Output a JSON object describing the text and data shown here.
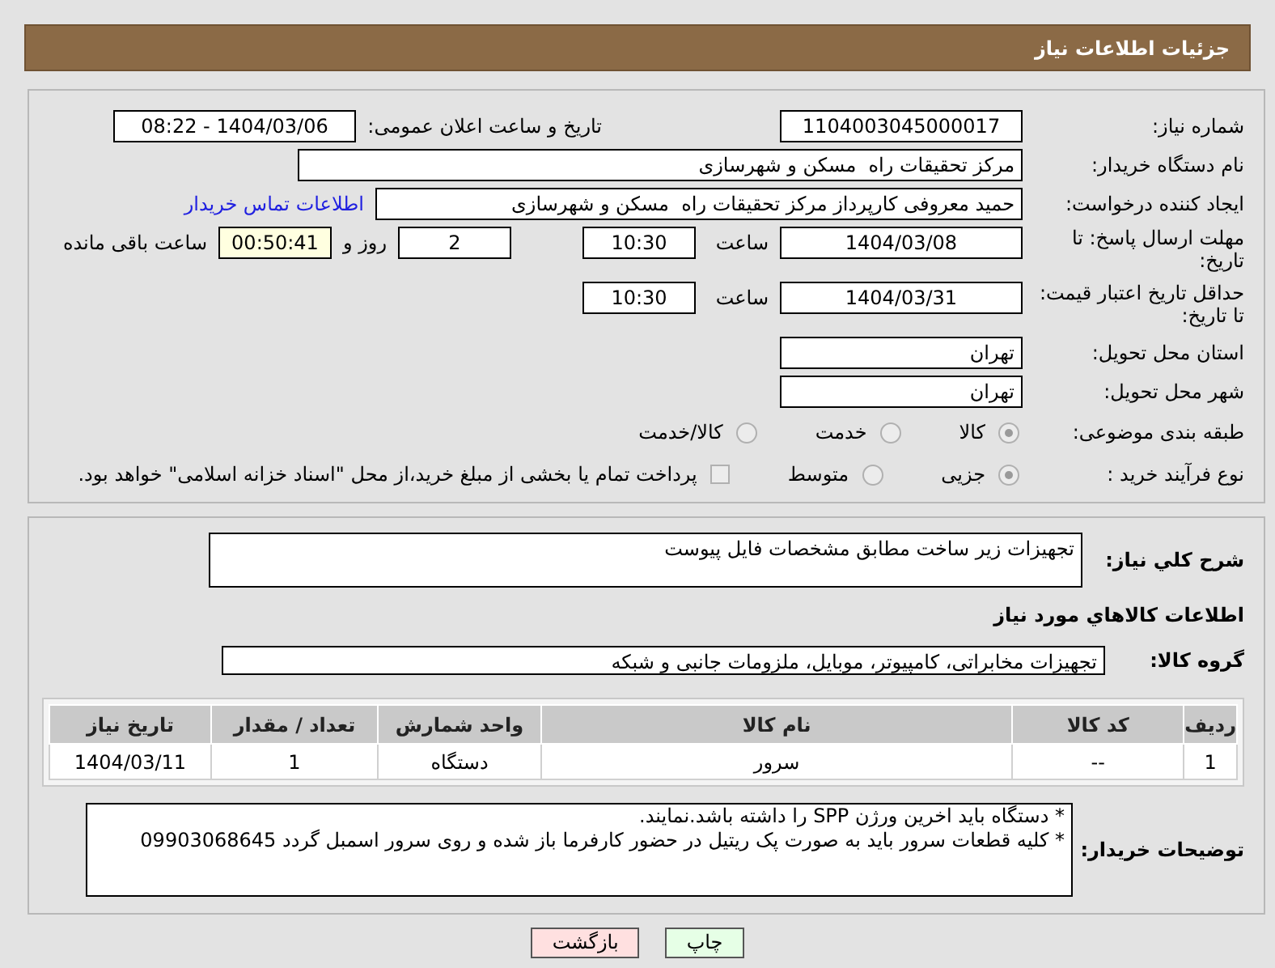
{
  "header": {
    "title": "جزئیات اطلاعات نیاز"
  },
  "need_number": {
    "label": "شماره نیاز:",
    "value": "1104003045000017"
  },
  "announce": {
    "label": "تاریخ و ساعت اعلان عمومی:",
    "value": "1404/03/06 - 08:22"
  },
  "buyer_org": {
    "label": "نام دستگاه خریدار:",
    "value": "مرکز تحقیقات راه  مسکن و شهرسازی"
  },
  "requester": {
    "label": "ایجاد کننده درخواست:",
    "value": "حمید معروفی کارپرداز مرکز تحقیقات راه  مسکن و شهرسازی",
    "link": "اطلاعات تماس خریدار"
  },
  "reply_deadline": {
    "label": "مهلت ارسال پاسخ: تا تاریخ:",
    "date": "1404/03/08",
    "time_label": "ساعت",
    "time": "10:30",
    "days": "2",
    "days_label": "روز و",
    "remaining": "00:50:41",
    "remaining_label": "ساعت باقی مانده"
  },
  "price_validity": {
    "label": "حداقل تاریخ اعتبار قیمت: تا تاریخ:",
    "date": "1404/03/31",
    "time_label": "ساعت",
    "time": "10:30"
  },
  "province": {
    "label": "استان محل تحویل:",
    "value": "تهران"
  },
  "city": {
    "label": "شهر محل تحویل:",
    "value": "تهران"
  },
  "category": {
    "label": "طبقه بندی موضوعی:",
    "options": [
      {
        "label": "کالا",
        "selected": true
      },
      {
        "label": "خدمت",
        "selected": false
      },
      {
        "label": "کالا/خدمت",
        "selected": false
      }
    ]
  },
  "process": {
    "label": "نوع فرآیند خرید :",
    "options": [
      {
        "label": "جزیی",
        "selected": true
      },
      {
        "label": "متوسط",
        "selected": false
      }
    ],
    "treasury": {
      "label": "پرداخت تمام یا بخشی از مبلغ خرید،از محل \"اسناد خزانه اسلامی\" خواهد بود.",
      "checked": false
    }
  },
  "description": {
    "label": "شرح کلي نياز:",
    "value": "تجهیزات زیر ساخت مطابق مشخصات فایل پیوست"
  },
  "items_title": "اطلاعات كالاهاي مورد نياز",
  "goods_group": {
    "label": "گروه کالا:",
    "value": "تجهیزات مخابراتی، کامپیوتر، موبایل، ملزومات جانبی و شبکه"
  },
  "table": {
    "columns": [
      "ردیف",
      "کد کالا",
      "نام کالا",
      "واحد شمارش",
      "تعداد / مقدار",
      "تاریخ نیاز"
    ],
    "rows": [
      [
        "1",
        "--",
        "سرور",
        "دستگاه",
        "1",
        "1404/03/11"
      ]
    ]
  },
  "buyer_notes": {
    "label": "توضیحات خریدار:",
    "lines": [
      "* دستگاه باید اخرین ورژن SPP را داشته باشد.نمایند.",
      "* کلیه قطعات سرور باید به صورت پک ریتیل در حضور کارفرما باز شده و روی سرور اسمبل گردد 09903068645"
    ]
  },
  "buttons": [
    {
      "kind": "print",
      "label": "چاپ"
    },
    {
      "kind": "back",
      "label": "بازگشت"
    }
  ]
}
